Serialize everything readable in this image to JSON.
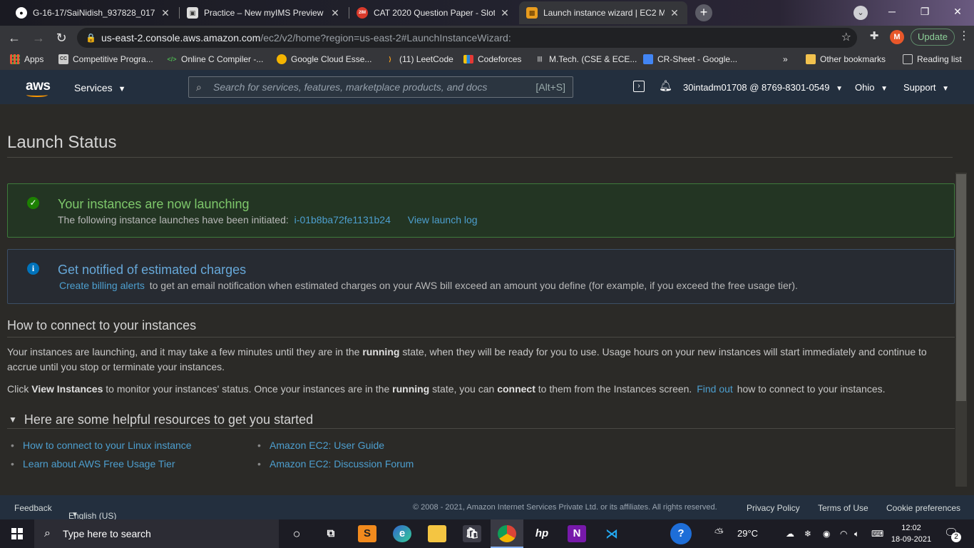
{
  "browser": {
    "tabs": [
      {
        "title": "G-16-17/SaiNidish_937828_017",
        "icon": "github-icon",
        "active": false
      },
      {
        "title": "Practice – New myIMS Preview",
        "icon": "ims-icon",
        "active": false
      },
      {
        "title": "CAT 2020 Question Paper - Slot",
        "icon": "2im-icon",
        "icon_text": "2IM",
        "active": false
      },
      {
        "title": "Launch instance wizard | EC2 M...",
        "icon": "aws-box-icon",
        "active": true
      }
    ],
    "new_tab": "+",
    "url_host": "us-east-2.console.aws.amazon.com",
    "url_path": "/ec2/v2/home?region=us-east-2#LaunchInstanceWizard:",
    "profile_initial": "M",
    "update_label": "Update",
    "bookmarks": [
      {
        "label": "Apps",
        "icon": "apps-grid-icon"
      },
      {
        "label": "Competitive Progra...",
        "icon": "cc-icon",
        "icon_text": "CC"
      },
      {
        "label": "Online C Compiler -...",
        "icon": "code-icon",
        "icon_text": "</>"
      },
      {
        "label": "Google Cloud Esse...",
        "icon": "qwiklabs-icon"
      },
      {
        "label": "(11) LeetCode",
        "icon": "leetcode-icon"
      },
      {
        "label": "Codeforces",
        "icon": "codeforces-icon"
      },
      {
        "label": "M.Tech. (CSE & ECE...",
        "icon": "iiit-icon"
      },
      {
        "label": "CR-Sheet - Google...",
        "icon": "google-sheets-icon"
      }
    ],
    "bookmarks_overflow": "»",
    "other_bookmarks": "Other bookmarks",
    "reading_list": "Reading list"
  },
  "aws_header": {
    "logo": "aws",
    "services_label": "Services",
    "search_placeholder": "Search for services, features, marketplace products, and docs",
    "search_shortcut": "[Alt+S]",
    "account": "30intadm01708 @ 8769-8301-0549",
    "region": "Ohio",
    "support": "Support"
  },
  "page": {
    "title": "Launch Status",
    "success": {
      "heading": "Your instances are now launching",
      "body": "The following instance launches have been initiated:",
      "instance_id": "i-01b8ba72fe1131b24",
      "log_link": "View launch log"
    },
    "info": {
      "heading": "Get notified of estimated charges",
      "link": "Create billing alerts",
      "body": "to get an email notification when estimated charges on your AWS bill exceed an amount you define (for example, if you exceed the free usage tier)."
    },
    "connect": {
      "heading": "How to connect to your instances",
      "p1_a": "Your instances are launching, and it may take a few minutes until they are in the",
      "p1_b": "running",
      "p1_c": "state, when they will be ready for you to use. Usage hours on your new instances will start immediately and continue to accrue until you stop or terminate your instances.",
      "p2_a": "Click",
      "p2_b": "View Instances",
      "p2_c": "to monitor your instances' status. Once your instances are in the",
      "p2_d": "running",
      "p2_e": "state, you can",
      "p2_f": "connect",
      "p2_g": "to them from the Instances screen.",
      "p2_link": "Find out",
      "p2_h": "how to connect to your instances."
    },
    "resources": {
      "heading": "Here are some helpful resources to get you started",
      "links": [
        "How to connect to your Linux instance",
        "Learn about AWS Free Usage Tier",
        "Amazon EC2: User Guide",
        "Amazon EC2: Discussion Forum"
      ]
    }
  },
  "footer": {
    "feedback": "Feedback",
    "language": "English (US)",
    "copyright": "© 2008 - 2021, Amazon Internet Services Private Ltd. or its affiliates. All rights reserved.",
    "privacy": "Privacy Policy",
    "terms": "Terms of Use",
    "cookies": "Cookie preferences"
  },
  "taskbar": {
    "search_placeholder": "Type here to search",
    "apps": [
      "task-view-icon",
      "sublime-icon",
      "edge-icon",
      "file-explorer-icon",
      "store-icon",
      "chrome-icon",
      "hp-icon",
      "onenote-icon",
      "vscode-icon",
      "help-icon"
    ],
    "temperature": "29°C",
    "time": "12:02",
    "date": "18-09-2021",
    "notifications": "2"
  },
  "colors": {
    "aws_nav": "#232f3e",
    "success_bg": "#233523",
    "success_border": "#3e7a3c",
    "success_icon": "#1d8102",
    "info_icon": "#0073bb",
    "link": "#4d9fcf"
  }
}
